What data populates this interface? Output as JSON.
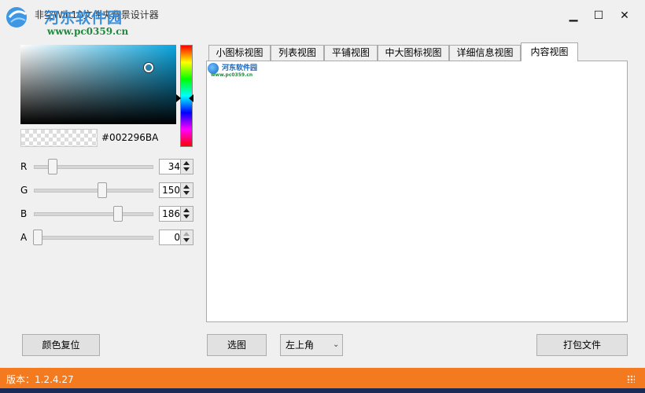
{
  "window": {
    "title": "非空Win10文件夹背景设计器",
    "minimize": "▁",
    "maximize": "☐",
    "close": "✕"
  },
  "watermark": {
    "name": "河东软件园",
    "url": "www.pc0359.cn"
  },
  "color_picker": {
    "hex": "#002296BA",
    "current_color": "#0aa6e0",
    "channels": [
      {
        "label": "R",
        "value": "34",
        "level": 34
      },
      {
        "label": "G",
        "value": "150",
        "level": 150
      },
      {
        "label": "B",
        "value": "186",
        "level": 186
      },
      {
        "label": "A",
        "value": "0",
        "level": 0
      }
    ]
  },
  "tabs": [
    {
      "label": "小图标视图"
    },
    {
      "label": "列表视图"
    },
    {
      "label": "平铺视图"
    },
    {
      "label": "中大图标视图"
    },
    {
      "label": "详细信息视图"
    },
    {
      "label": "内容视图",
      "active": true
    }
  ],
  "content_preview": {
    "logo_name": "河东软件园",
    "logo_url": "www.pc0359.cn"
  },
  "buttons": {
    "reset": "颜色复位",
    "select_image": "选图",
    "position": "左上角",
    "pack": "打包文件"
  },
  "status": {
    "version": "版本：1.2.4.27"
  },
  "colors": {
    "status_bar": "#f47a1f",
    "accent_blue": "#2a86d8"
  }
}
